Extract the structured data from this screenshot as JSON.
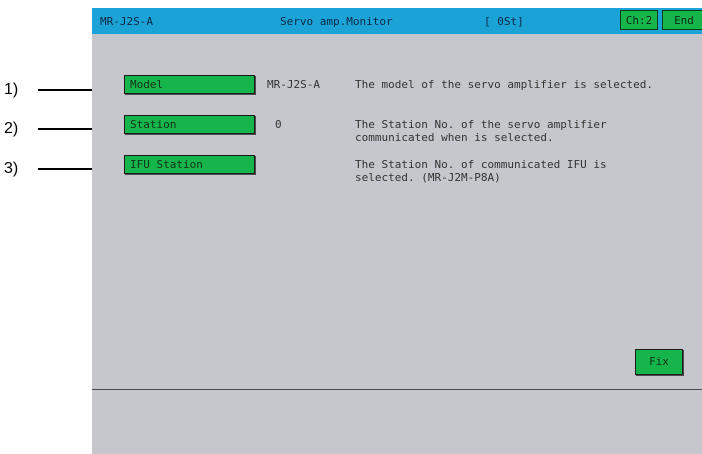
{
  "callouts": [
    "1)",
    "2)",
    "3)"
  ],
  "titlebar": {
    "model": "MR-J2S-A",
    "title": "Servo amp.Monitor",
    "status": "[ 0St]",
    "ch_label": "Ch:2",
    "end_label": "End"
  },
  "fields": [
    {
      "label": "Model",
      "value": "MR-J2S-A",
      "description": "The model of the servo amplifier is selected."
    },
    {
      "label": "Station",
      "value": "0",
      "description": "The Station No. of the servo amplifier\ncommunicated when is selected."
    },
    {
      "label": "IFU Station",
      "value": "",
      "description": "The Station No. of communicated IFU is\nselected. (MR-J2M-P8A)"
    }
  ],
  "fix_label": "Fix",
  "colors": {
    "title_bar": "#1ba3d8",
    "button": "#16b54b",
    "background": "#c5c7cc"
  }
}
